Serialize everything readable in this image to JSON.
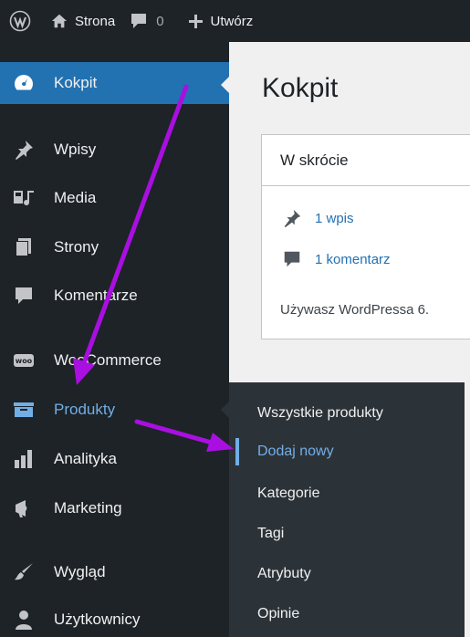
{
  "adminbar": {
    "site_name": "Strona",
    "comment_count": "0",
    "new_label": "Utwórz"
  },
  "sidebar": {
    "items": [
      {
        "label": "Kokpit",
        "icon": "dashboard-icon"
      },
      {
        "label": "Wpisy",
        "icon": "pin-icon"
      },
      {
        "label": "Media",
        "icon": "media-icon"
      },
      {
        "label": "Strony",
        "icon": "pages-icon"
      },
      {
        "label": "Komentarze",
        "icon": "comment-icon"
      },
      {
        "label": "WooCommerce",
        "icon": "woo-icon"
      },
      {
        "label": "Produkty",
        "icon": "archive-icon"
      },
      {
        "label": "Analityka",
        "icon": "chart-bar-icon"
      },
      {
        "label": "Marketing",
        "icon": "megaphone-icon"
      },
      {
        "label": "Wygląd",
        "icon": "brush-icon"
      },
      {
        "label": "Użytkownicy",
        "icon": "user-icon"
      }
    ]
  },
  "flyout": {
    "items": [
      "Wszystkie produkty",
      "Dodaj nowy",
      "Kategorie",
      "Tagi",
      "Atrybuty",
      "Opinie"
    ]
  },
  "content": {
    "page_title": "Kokpit",
    "box_title": "W skrócie",
    "posts_link": "1 wpis",
    "comments_link": "1 komentarz",
    "version_text": "Używasz WordPressa 6."
  },
  "colors": {
    "sidebar_bg": "#1d2327",
    "accent": "#2271b1",
    "highlight": "#72aee6",
    "annotation_arrow": "#a80fe0"
  }
}
